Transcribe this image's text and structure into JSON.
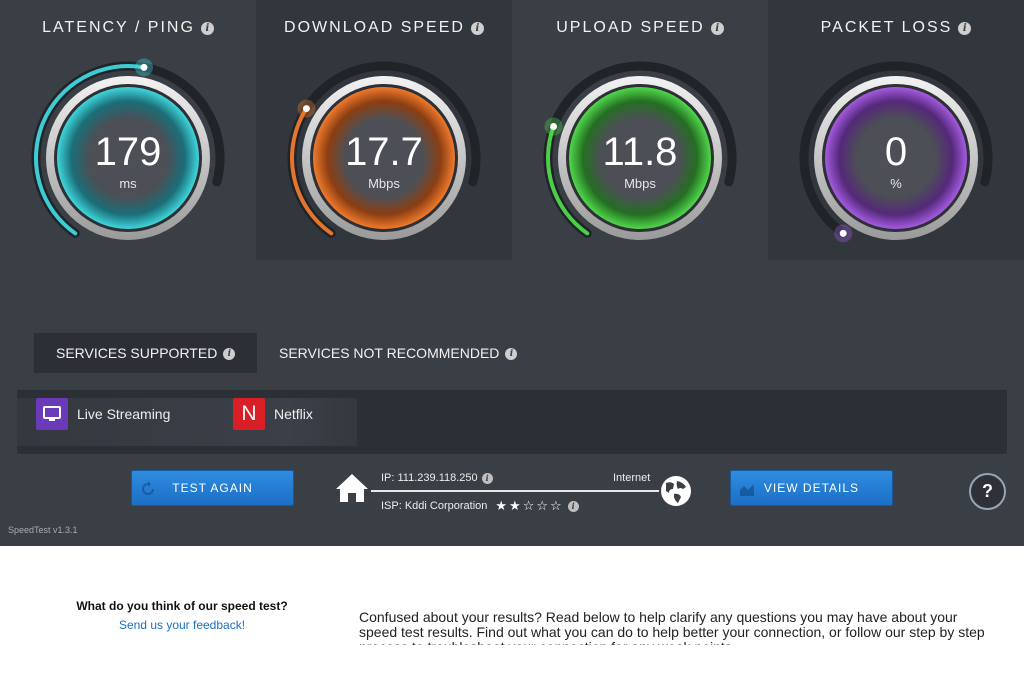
{
  "gauges": [
    {
      "title": "LATENCY / PING",
      "value": "179",
      "unit": "ms",
      "color": "#3fd6dc",
      "dark": "#1b6e78",
      "fill": 0.62
    },
    {
      "title": "DOWNLOAD SPEED",
      "value": "17.7",
      "unit": "Mbps",
      "color": "#f07a2c",
      "dark": "#8c3e12",
      "fill": 0.35
    },
    {
      "title": "UPLOAD SPEED",
      "value": "11.8",
      "unit": "Mbps",
      "color": "#4fd84a",
      "dark": "#256e23",
      "fill": 0.3
    },
    {
      "title": "PACKET LOSS",
      "value": "0",
      "unit": "%",
      "color": "#a45be0",
      "dark": "#55297a",
      "fill": 0.0
    }
  ],
  "tabs": {
    "supported": "SERVICES SUPPORTED",
    "not_recommended": "SERVICES NOT RECOMMENDED"
  },
  "services": [
    {
      "name": "Live Streaming",
      "icon": "tv-icon",
      "color": "#6a3ab8"
    },
    {
      "name": "Netflix",
      "icon": "netflix-icon",
      "color": "#d81f26",
      "glyph": "N"
    }
  ],
  "buttons": {
    "test_again": "TEST AGAIN",
    "view_details": "VIEW DETAILS"
  },
  "network": {
    "ip": "IP: 111.239.118.250",
    "isp": "ISP: Kddi Corporation",
    "internet": "Internet",
    "rating": 2,
    "rating_max": 5
  },
  "help_label": "?",
  "version": "SpeedTest v1.3.1",
  "feedback": {
    "question": "What do you think of our speed test?",
    "link": "Send us your feedback!"
  },
  "confused_text": "Confused about your results? Read below to help clarify any questions you may have about your speed test results. Find out what you can do to help better your connection, or follow our step by step process to troubleshoot your connection for any weak points."
}
